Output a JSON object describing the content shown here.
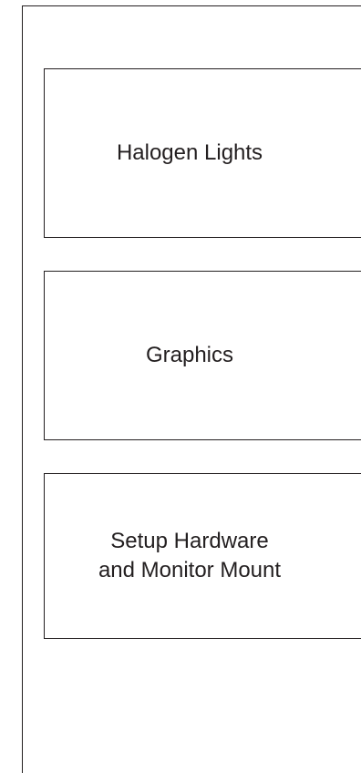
{
  "boxes": [
    {
      "label": "Halogen Lights"
    },
    {
      "label": "Graphics"
    },
    {
      "label": "Setup Hardware\nand Monitor Mount"
    }
  ],
  "colors": {
    "stroke": "#231f20",
    "text": "#231f20",
    "background": "#ffffff"
  }
}
